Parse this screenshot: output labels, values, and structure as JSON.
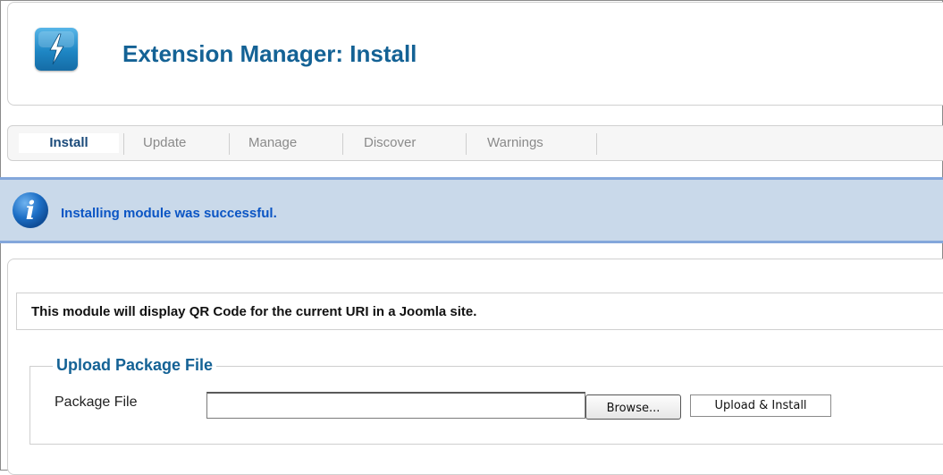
{
  "header": {
    "title": "Extension Manager: Install",
    "logo_icon": "lightning-bolt-icon",
    "accent_color": "#146295"
  },
  "tabs": [
    {
      "label": "Install",
      "active": true
    },
    {
      "label": "Update",
      "active": false
    },
    {
      "label": "Manage",
      "active": false
    },
    {
      "label": "Discover",
      "active": false
    },
    {
      "label": "Warnings",
      "active": false
    }
  ],
  "message": {
    "icon": "info-icon",
    "text": "Installing module was successful.",
    "background_color": "#c9d9ea",
    "text_color": "#0b55c4"
  },
  "content": {
    "description": "This module will display QR Code for the current URI in a Joomla site.",
    "upload": {
      "legend": "Upload Package File",
      "field_label": "Package File",
      "file_value": "",
      "browse_label": "Browse...",
      "submit_label": "Upload & Install"
    }
  }
}
